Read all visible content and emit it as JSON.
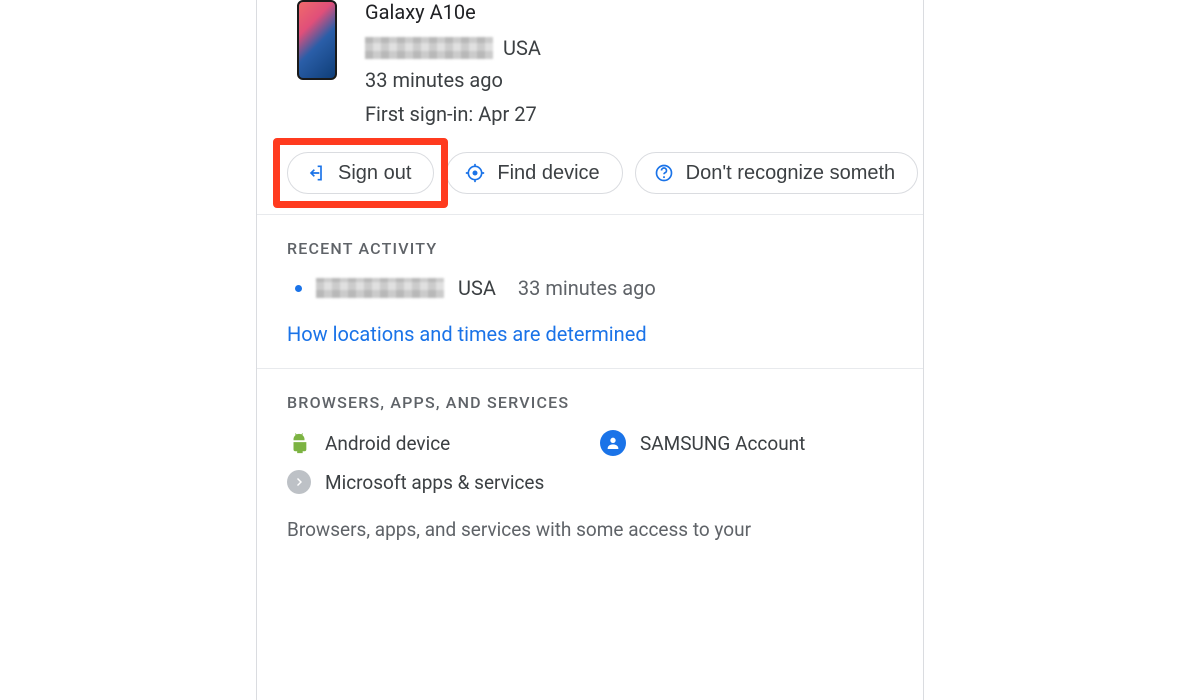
{
  "device": {
    "name": "Galaxy A10e",
    "location_suffix": "USA",
    "last_seen": "33 minutes ago",
    "first_signin_label": "First sign-in: Apr 27"
  },
  "actions": {
    "signout": "Sign out",
    "find": "Find device",
    "dontrecognize": "Don't recognize someth"
  },
  "recent": {
    "title": "Recent Activity",
    "item": {
      "location_suffix": "USA",
      "time": "33 minutes ago"
    },
    "link": "How locations and times are determined"
  },
  "apps_section": {
    "title": "Browsers, Apps, and Services",
    "items": {
      "android": "Android device",
      "samsung": "SAMSUNG Account",
      "microsoft": "Microsoft apps & services"
    },
    "description": "Browsers, apps, and services with some access to your"
  },
  "highlight": {
    "on": "signout"
  }
}
